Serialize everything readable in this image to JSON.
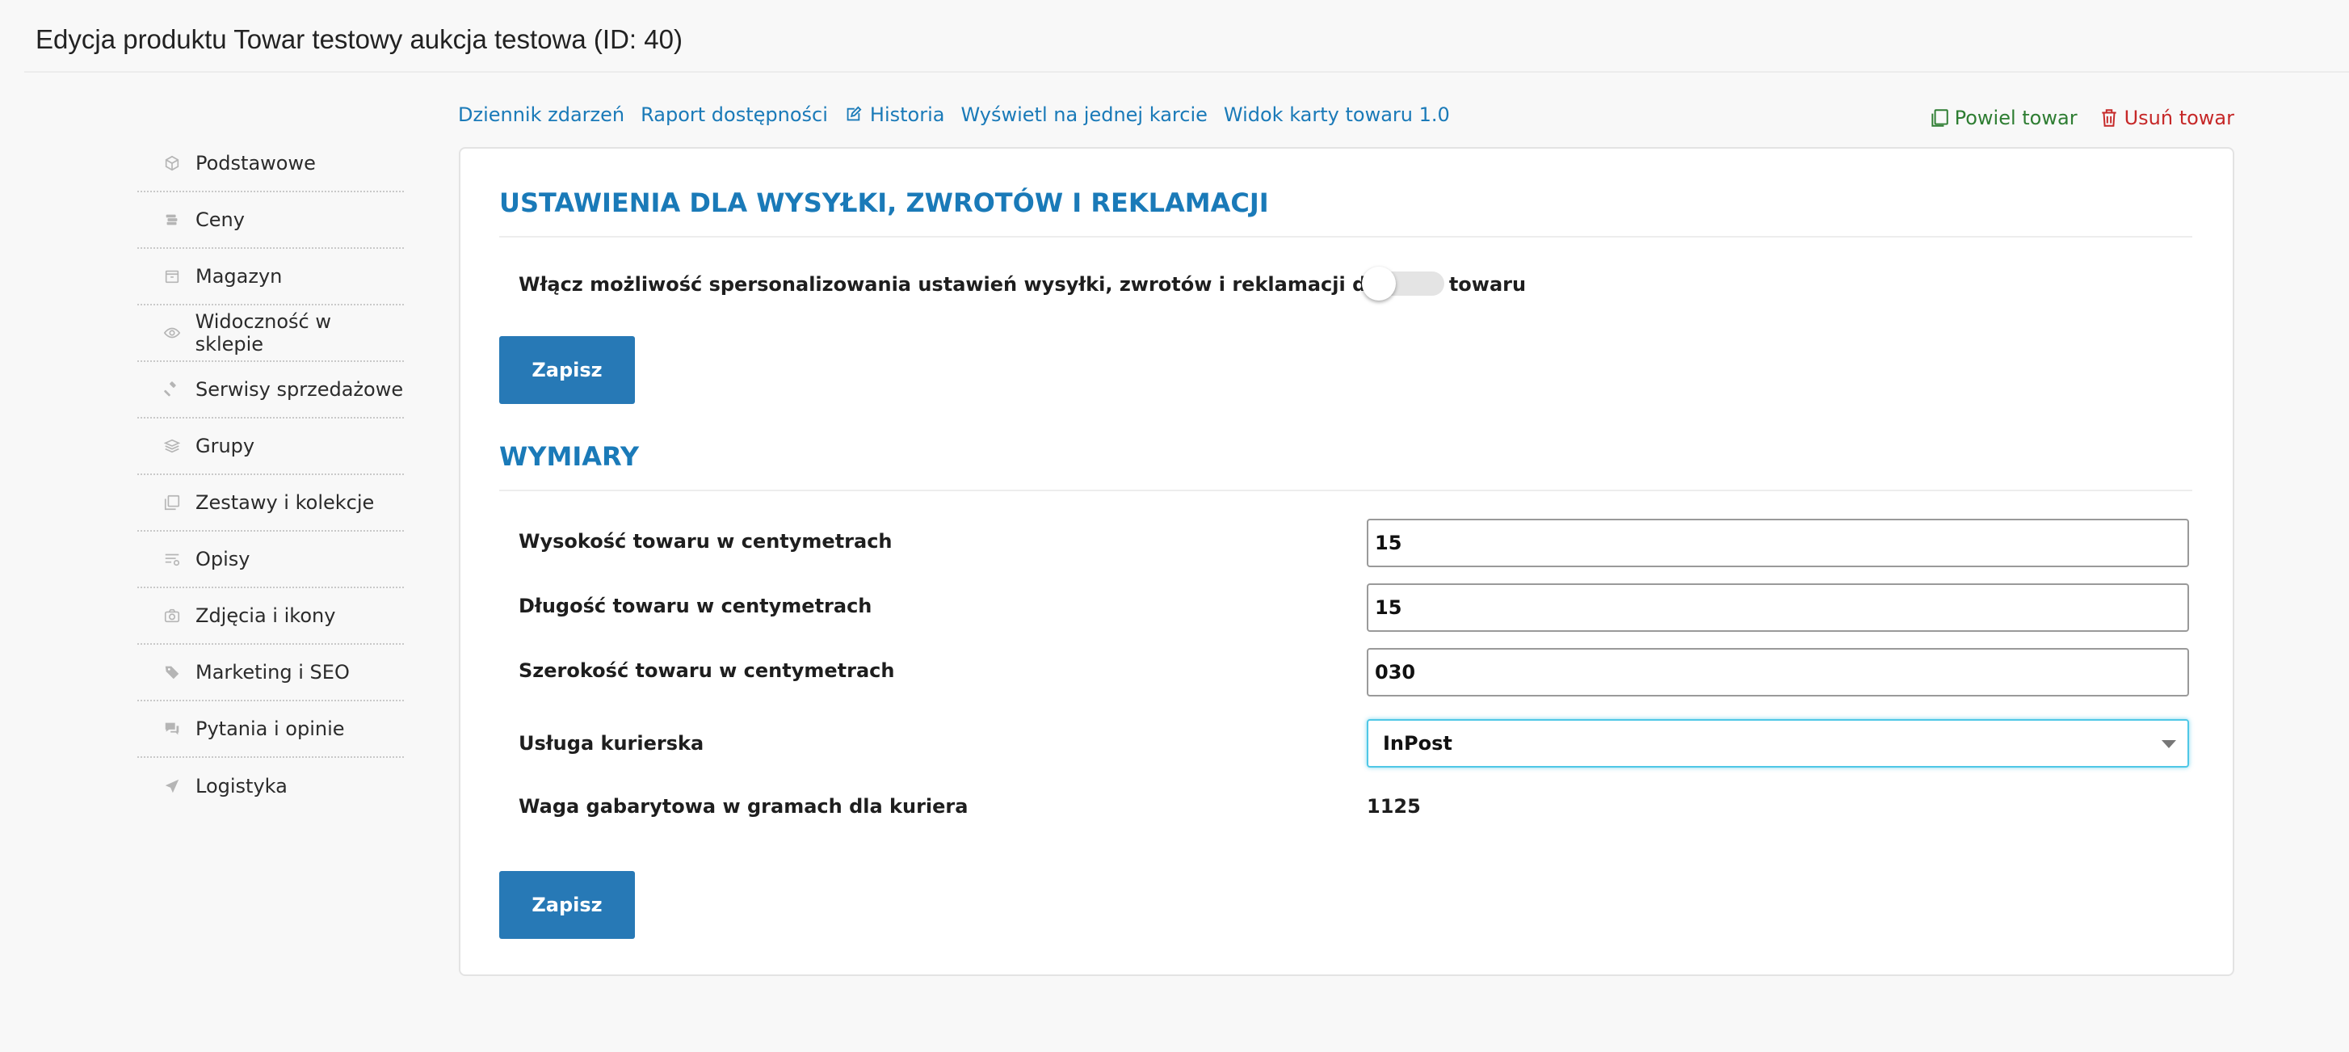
{
  "header": {
    "title": "Edycja produktu Towar testowy aukcja testowa (ID: 40)"
  },
  "sidebar": {
    "items": [
      {
        "label": "Podstawowe",
        "icon": "cube-icon"
      },
      {
        "label": "Ceny",
        "icon": "price-tag-icon"
      },
      {
        "label": "Magazyn",
        "icon": "box-icon"
      },
      {
        "label": "Widoczność w sklepie",
        "icon": "eye-icon"
      },
      {
        "label": "Serwisy sprzedażowe",
        "icon": "gavel-icon"
      },
      {
        "label": "Grupy",
        "icon": "layers-icon"
      },
      {
        "label": "Zestawy i kolekcje",
        "icon": "collection-icon"
      },
      {
        "label": "Opisy",
        "icon": "description-icon"
      },
      {
        "label": "Zdjęcia i ikony",
        "icon": "camera-icon"
      },
      {
        "label": "Marketing i SEO",
        "icon": "tags-icon"
      },
      {
        "label": "Pytania i opinie",
        "icon": "comments-icon"
      },
      {
        "label": "Logistyka",
        "icon": "send-icon"
      }
    ]
  },
  "top_links": {
    "event_log": "Dziennik zdarzeń",
    "availability_report": "Raport dostępności",
    "history": "Historia",
    "single_card": "Wyświetl na jednej karcie",
    "card_view": "Widok karty towaru 1.0"
  },
  "actions": {
    "duplicate": "Powiel towar",
    "delete": "Usuń towar"
  },
  "shipping_section": {
    "title": "USTAWIENIA DLA WYSYŁKI, ZWROTÓW I REKLAMACJI",
    "toggle_label": "Włącz możliwość spersonalizowania ustawień wysyłki, zwrotów i reklamacji dla tego towaru",
    "toggle_on": false,
    "save_label": "Zapisz"
  },
  "dimensions_section": {
    "title": "WYMIARY",
    "height_label": "Wysokość towaru w centymetrach",
    "height_value": "15",
    "length_label": "Długość towaru w centymetrach",
    "length_value": "15",
    "width_label": "Szerokość towaru w centymetrach",
    "width_value": "030",
    "courier_label": "Usługa kurierska",
    "courier_value": "InPost",
    "weight_label": "Waga gabarytowa w gramach dla kuriera",
    "weight_value": "1125",
    "save_label": "Zapisz"
  },
  "colors": {
    "accent": "#2779b6",
    "link": "#1a7ab8",
    "success": "#2e7d32",
    "danger": "#c62828",
    "focus": "#4fc7e6"
  }
}
